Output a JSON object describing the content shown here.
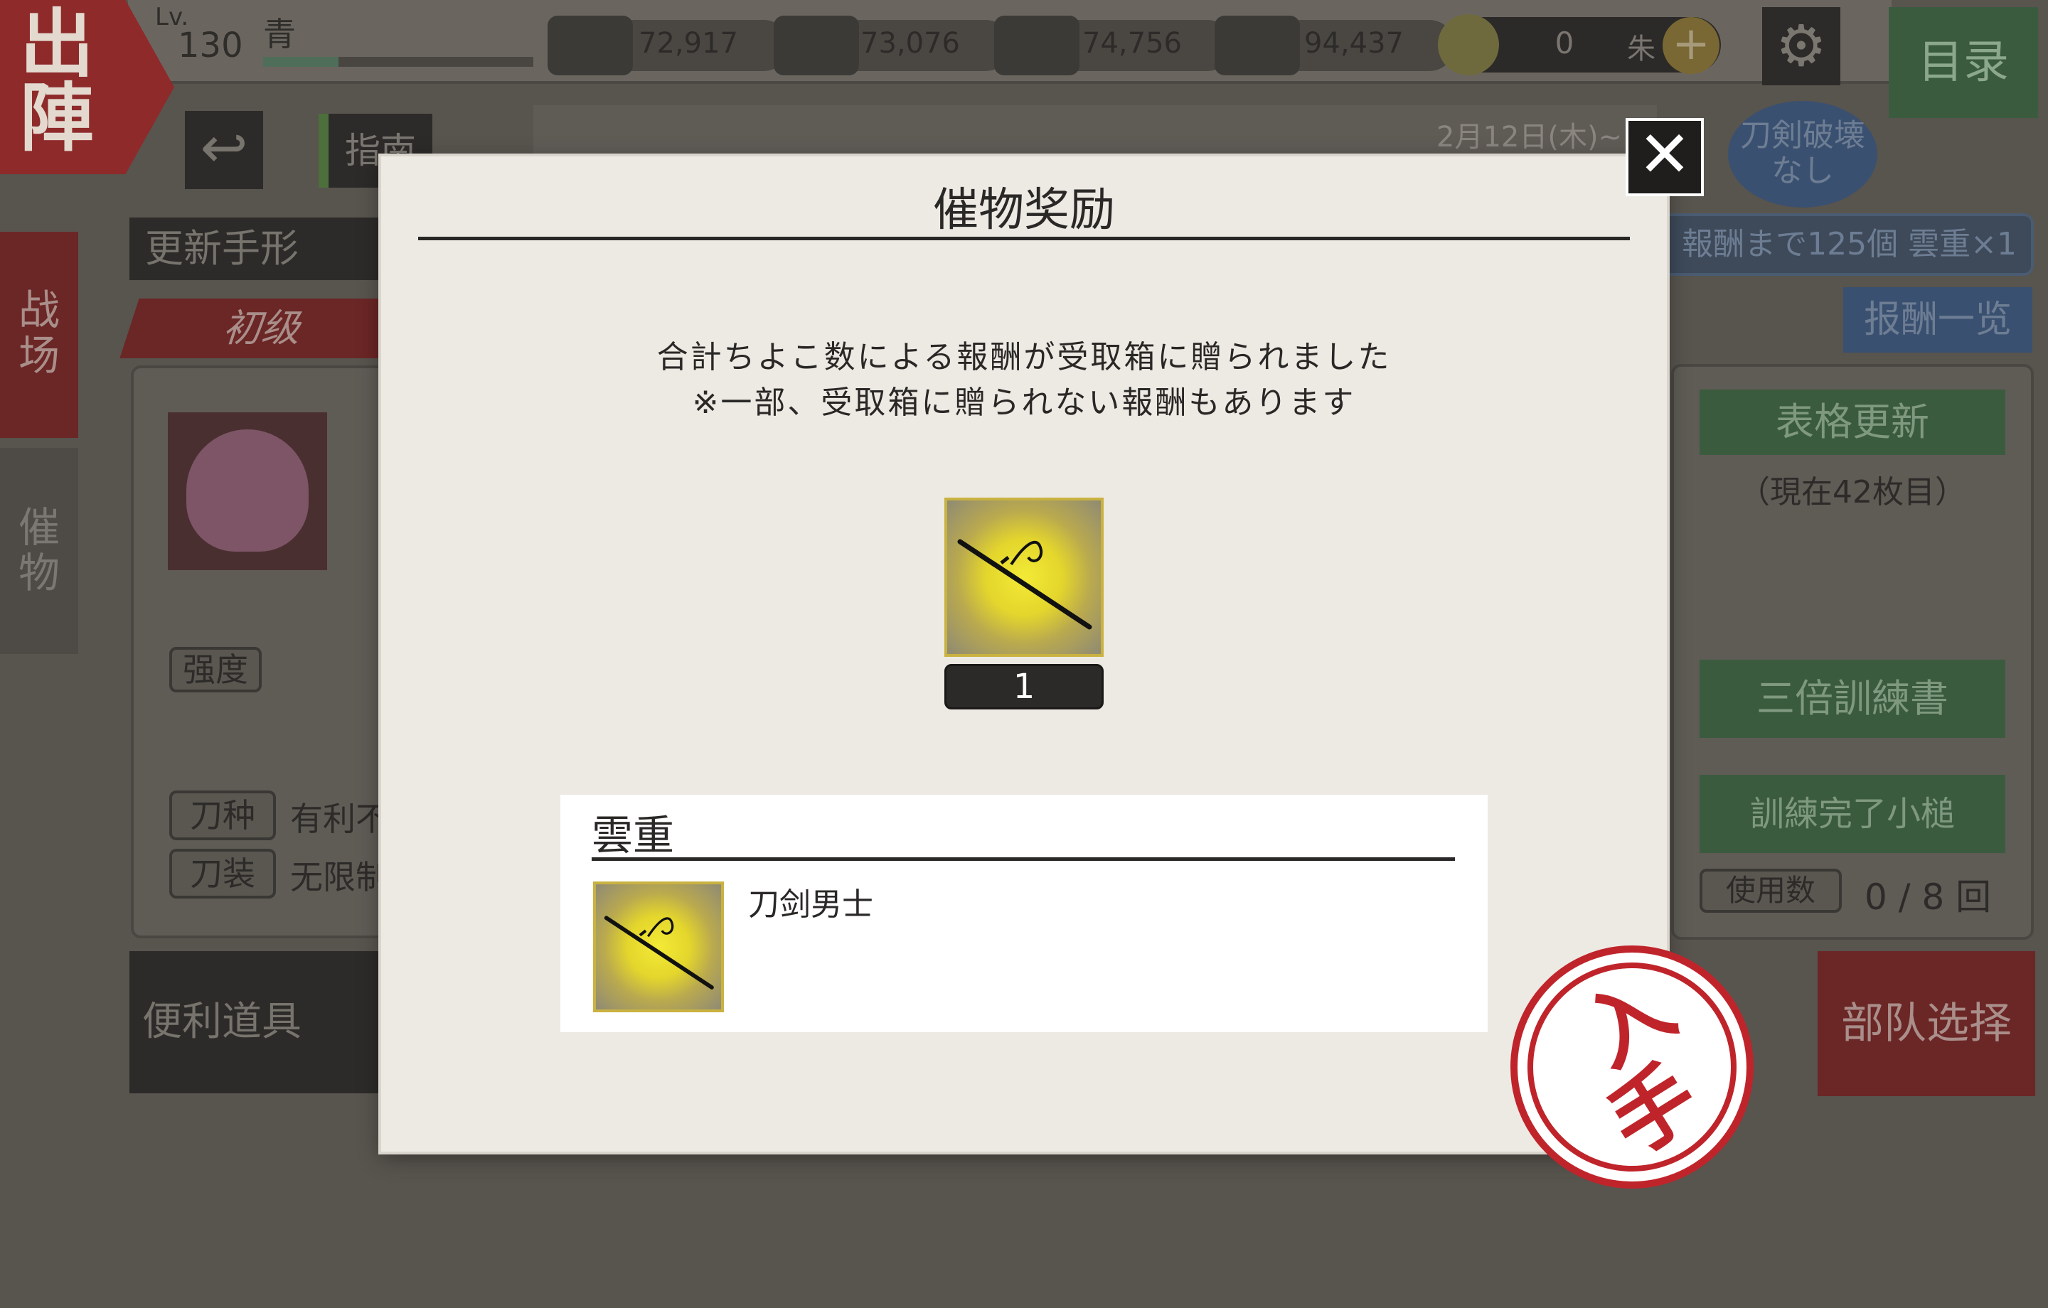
{
  "hud": {
    "sortie_label": "出陣",
    "level_prefix": "Lv.",
    "level": "130",
    "player_name": "青",
    "exp_fraction": 0.28,
    "resources": [
      {
        "icon": "charcoal-icon",
        "value": "72,917"
      },
      {
        "icon": "whetstone-icon",
        "value": "73,076"
      },
      {
        "icon": "cooling-material-icon",
        "value": "74,756"
      },
      {
        "icon": "steel-icon",
        "value": "94,437"
      }
    ],
    "koban": {
      "value": "0",
      "unit": "朱"
    },
    "menu_label": "目录"
  },
  "nav": {
    "guide_label": "指南",
    "update_pass_label": "更新手形",
    "tab_battle": "战场",
    "tab_event": "催物",
    "level_tab": "初级",
    "event_date": "2月12日(木)~"
  },
  "panels": {
    "convenience_items": "便利道具",
    "strength_label": "强度",
    "sword_type_label": "刀种",
    "sword_type_value": "有利不",
    "equip_label": "刀装",
    "equip_value": "无限制",
    "no_break_label": "刀剣破壊なし",
    "reward_count_text": "報酬まで125個 雲重×1",
    "reward_list_label": "报酬一览",
    "table_refresh_label": "表格更新",
    "table_refresh_note": "（現在42枚目）",
    "triple_book_label": "三倍訓練書",
    "complete_hammer_label": "訓練完了小槌",
    "use_count_label": "使用数",
    "use_count_value": "0 / 8 回",
    "squad_select_label": "部队选择"
  },
  "modal": {
    "title": "催物奖励",
    "message_line1": "合計ちよこ数による報酬が受取箱に贈られました",
    "message_line2": "※一部、受取箱に贈られない報酬もあります",
    "reward": {
      "icon": "katana-icon",
      "quantity": "1"
    },
    "detail": {
      "name": "雲重",
      "type": "刀剑男士",
      "icon": "katana-icon"
    },
    "stamp_label": [
      "入",
      "手"
    ],
    "close_icon": "close-icon"
  },
  "colors": {
    "modal_bg": "#edeae4",
    "tile_gold": "#c9b241",
    "stamp_red": "#c0242b"
  }
}
